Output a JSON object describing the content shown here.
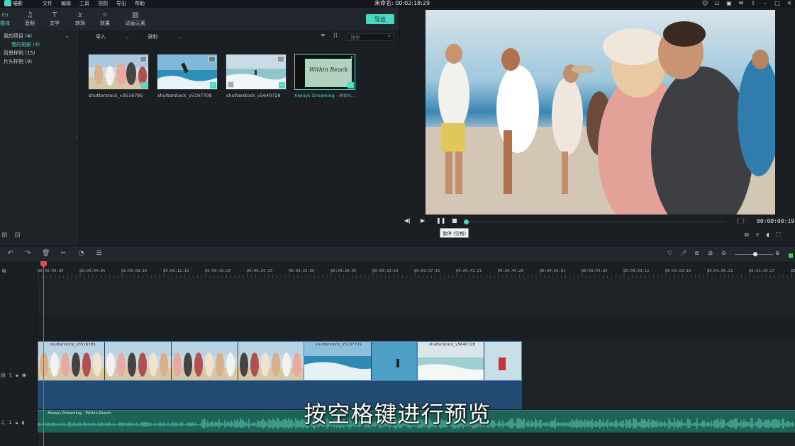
{
  "titlebar": {
    "logo_text": "喵影",
    "menu": [
      "文件",
      "编辑",
      "工具",
      "视图",
      "导出",
      "帮助"
    ],
    "project_title": "未命名: 00:02:18:29",
    "window_icons": [
      "user-icon",
      "cart-icon",
      "save-icon",
      "mail-icon",
      "download-icon",
      "minimize-icon",
      "maximize-icon",
      "close-icon"
    ]
  },
  "toolbar": {
    "tools": [
      {
        "label": "媒体",
        "icon": "folder-icon",
        "active": true
      },
      {
        "label": "音频",
        "icon": "music-note-icon",
        "active": false
      },
      {
        "label": "文字",
        "icon": "text-icon",
        "active": false
      },
      {
        "label": "转场",
        "icon": "transition-icon",
        "active": false
      },
      {
        "label": "效果",
        "icon": "effects-icon",
        "active": false
      },
      {
        "label": "动画元素",
        "icon": "image-icon",
        "active": false
      }
    ],
    "export_label": "导出"
  },
  "sidebar": {
    "items": [
      {
        "label": "我的项目 (4)",
        "sub": false
      },
      {
        "label": "我的相册 (4)",
        "sub": true
      },
      {
        "label": "背景样例 (15)",
        "sub": false
      },
      {
        "label": "片头样例 (9)",
        "sub": false
      }
    ]
  },
  "media": {
    "import_label": "导入",
    "record_label": "录制",
    "search_placeholder": "搜索",
    "items": [
      {
        "name": "shutterstock_v3516785",
        "selected": false
      },
      {
        "name": "shutterstock_v5197709",
        "selected": false
      },
      {
        "name": "shutterstock_v5640728",
        "selected": false
      },
      {
        "name": "Always Dreaming - Withi...",
        "selected": true,
        "thumb_text": "Within Reach"
      }
    ]
  },
  "preview": {
    "timecode": "00:00:00:19",
    "tooltip": "暂停 (空格)",
    "progress": 0.0
  },
  "timeline": {
    "ruler_labels": [
      "00:00:00:00",
      "00:00:04:05",
      "00:00:08:10",
      "00:00:12:15",
      "00:00:16:20",
      "00:00:20:25",
      "00:00:25:00",
      "00:00:29:05",
      "00:00:33:10",
      "00:00:37:15",
      "00:00:41:21",
      "00:00:45:26",
      "00:00:50:01",
      "00:00:54:06",
      "00:00:58:11",
      "00:01:02:16",
      "00:01:06:21",
      "00:01:10:27",
      "00:01:1"
    ],
    "video_track_label": "1",
    "audio_track_label": "1",
    "clips": [
      {
        "name": "shutterstock_v3516785"
      },
      {
        "name": "shutterstock_v5197709"
      },
      {
        "name": "shutterstock_v5640728"
      }
    ],
    "audio_clip": "Always Dreaming - Within Reach"
  },
  "subtitle": "按空格键进行预览",
  "colors": {
    "accent": "#4bd8c2",
    "playhead": "#e5484d",
    "video_clip": "#234a73",
    "audio_clip": "#1e6358"
  }
}
